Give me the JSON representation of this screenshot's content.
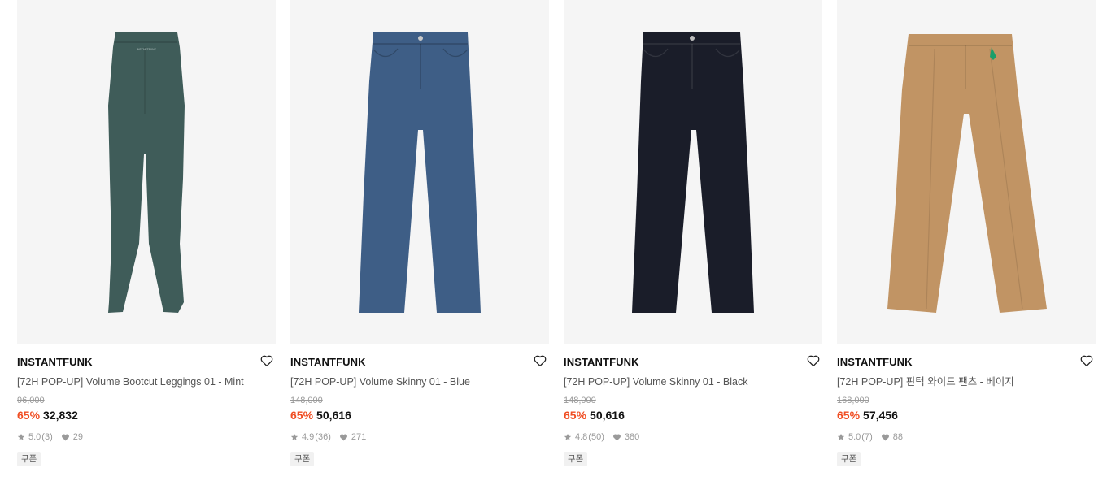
{
  "products": [
    {
      "brand": "INSTANTFUNK",
      "name": "[72H POP-UP] Volume Bootcut Leggings 01 - Mint",
      "original_price": "96,000",
      "discount": "65%",
      "price": "32,832",
      "rating": "5.0",
      "reviews": "(3)",
      "likes": "29",
      "badge": "쿠폰",
      "image_color": "#3f5c59",
      "image_kind": "leggings"
    },
    {
      "brand": "INSTANTFUNK",
      "name": "[72H POP-UP] Volume Skinny 01 - Blue",
      "original_price": "148,000",
      "discount": "65%",
      "price": "50,616",
      "rating": "4.9",
      "reviews": "(36)",
      "likes": "271",
      "badge": "쿠폰",
      "image_color": "#3e5e86",
      "image_kind": "jeans"
    },
    {
      "brand": "INSTANTFUNK",
      "name": "[72H POP-UP] Volume Skinny 01 - Black",
      "original_price": "148,000",
      "discount": "65%",
      "price": "50,616",
      "rating": "4.8",
      "reviews": "(50)",
      "likes": "380",
      "badge": "쿠폰",
      "image_color": "#1a1d29",
      "image_kind": "jeans"
    },
    {
      "brand": "INSTANTFUNK",
      "name": "[72H POP-UP] 핀턱 와이드 팬츠 - 베이지",
      "original_price": "168,000",
      "discount": "65%",
      "price": "57,456",
      "rating": "5.0",
      "reviews": "(7)",
      "likes": "88",
      "badge": "쿠폰",
      "image_color": "#c19464",
      "image_kind": "wide"
    }
  ],
  "icons": {
    "wishlist": "heart-outline-icon",
    "rating": "star-icon",
    "likes": "heart-filled-icon"
  },
  "colors": {
    "discount": "#f04e23",
    "image_bg": "#f5f5f5"
  }
}
